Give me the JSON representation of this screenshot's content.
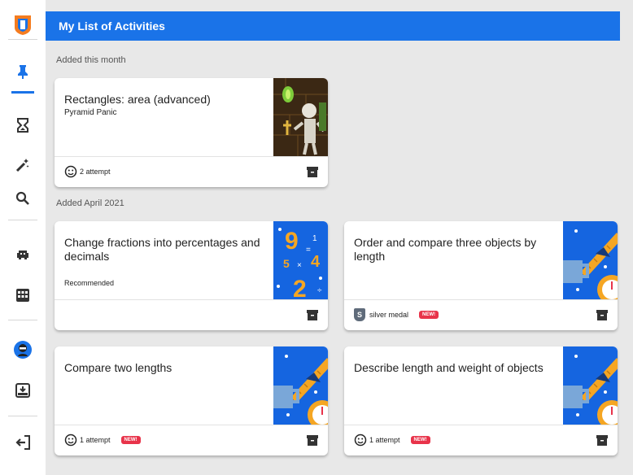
{
  "header": {
    "title": "My List of Activities"
  },
  "sidebar": {
    "items": [
      {
        "name": "logo-icon"
      },
      {
        "name": "pin-icon"
      },
      {
        "name": "hourglass-icon"
      },
      {
        "name": "magic-wand-icon"
      },
      {
        "name": "search-icon"
      },
      {
        "name": "alien-icon"
      },
      {
        "name": "grid-icon"
      },
      {
        "name": "avatar"
      },
      {
        "name": "inbox-icon"
      },
      {
        "name": "logout-icon"
      }
    ]
  },
  "sections": [
    {
      "label": "Added this month"
    },
    {
      "label": "Added April 2021"
    }
  ],
  "cards": [
    {
      "title": "Rectangles: area (advanced)",
      "subtitle": "Pyramid Panic",
      "recommended": "",
      "footer_text": "2 attempt",
      "footer_icon": "smiley-icon",
      "new": ""
    },
    {
      "title": "Change fractions into percentages and decimals",
      "subtitle": "",
      "recommended": "Recommended",
      "footer_text": "",
      "footer_icon": "",
      "new": ""
    },
    {
      "title": "Order and compare three objects by length",
      "subtitle": "",
      "recommended": "",
      "footer_text": "silver medal",
      "footer_icon": "medal-icon",
      "medal_letter": "S",
      "new": "NEW!"
    },
    {
      "title": "Compare two lengths",
      "subtitle": "",
      "recommended": "",
      "footer_text": "1 attempt",
      "footer_icon": "smiley-icon",
      "new": "NEW!"
    },
    {
      "title": "Describe length and weight of objects",
      "subtitle": "",
      "recommended": "",
      "footer_text": "1 attempt",
      "footer_icon": "smiley-icon",
      "new": "NEW!"
    }
  ],
  "colors": {
    "accent": "#1a73e8",
    "new_badge": "#e8334a",
    "background": "#e8e8e8"
  }
}
